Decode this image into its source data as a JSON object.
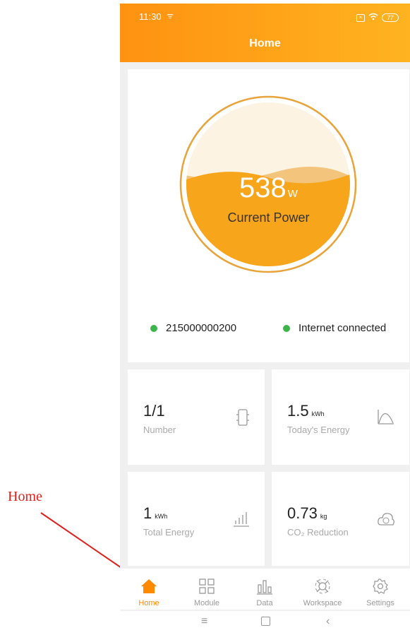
{
  "annotation": {
    "label": "Home"
  },
  "status_bar": {
    "time": "11:30",
    "battery": "77"
  },
  "header": {
    "title": "Home"
  },
  "power": {
    "value": "538",
    "unit": "W",
    "label": "Current Power",
    "fill_fraction": 0.55
  },
  "device": {
    "serial": "215000000200",
    "internet_status": "Internet connected",
    "status_color": "#3cb54a"
  },
  "stats": [
    {
      "value": "1/1",
      "unit": "",
      "label": "Number",
      "icon": "module-icon"
    },
    {
      "value": "1.5",
      "unit": "kWh",
      "label": "Today's Energy",
      "icon": "curve-icon"
    },
    {
      "value": "1",
      "unit": "kWh",
      "label": "Total Energy",
      "icon": "bar-chart-icon"
    },
    {
      "value": "0.73",
      "unit": "kg",
      "label": "CO₂ Reduction",
      "icon": "co2-cloud-icon"
    }
  ],
  "nav": [
    {
      "label": "Home",
      "active": true
    },
    {
      "label": "Module",
      "active": false
    },
    {
      "label": "Data",
      "active": false
    },
    {
      "label": "Workspace",
      "active": false
    },
    {
      "label": "Settings",
      "active": false
    }
  ],
  "colors": {
    "accent": "#ff9c15",
    "gauge_fill": "#f7a51b",
    "active_nav": "#ff8a00"
  }
}
